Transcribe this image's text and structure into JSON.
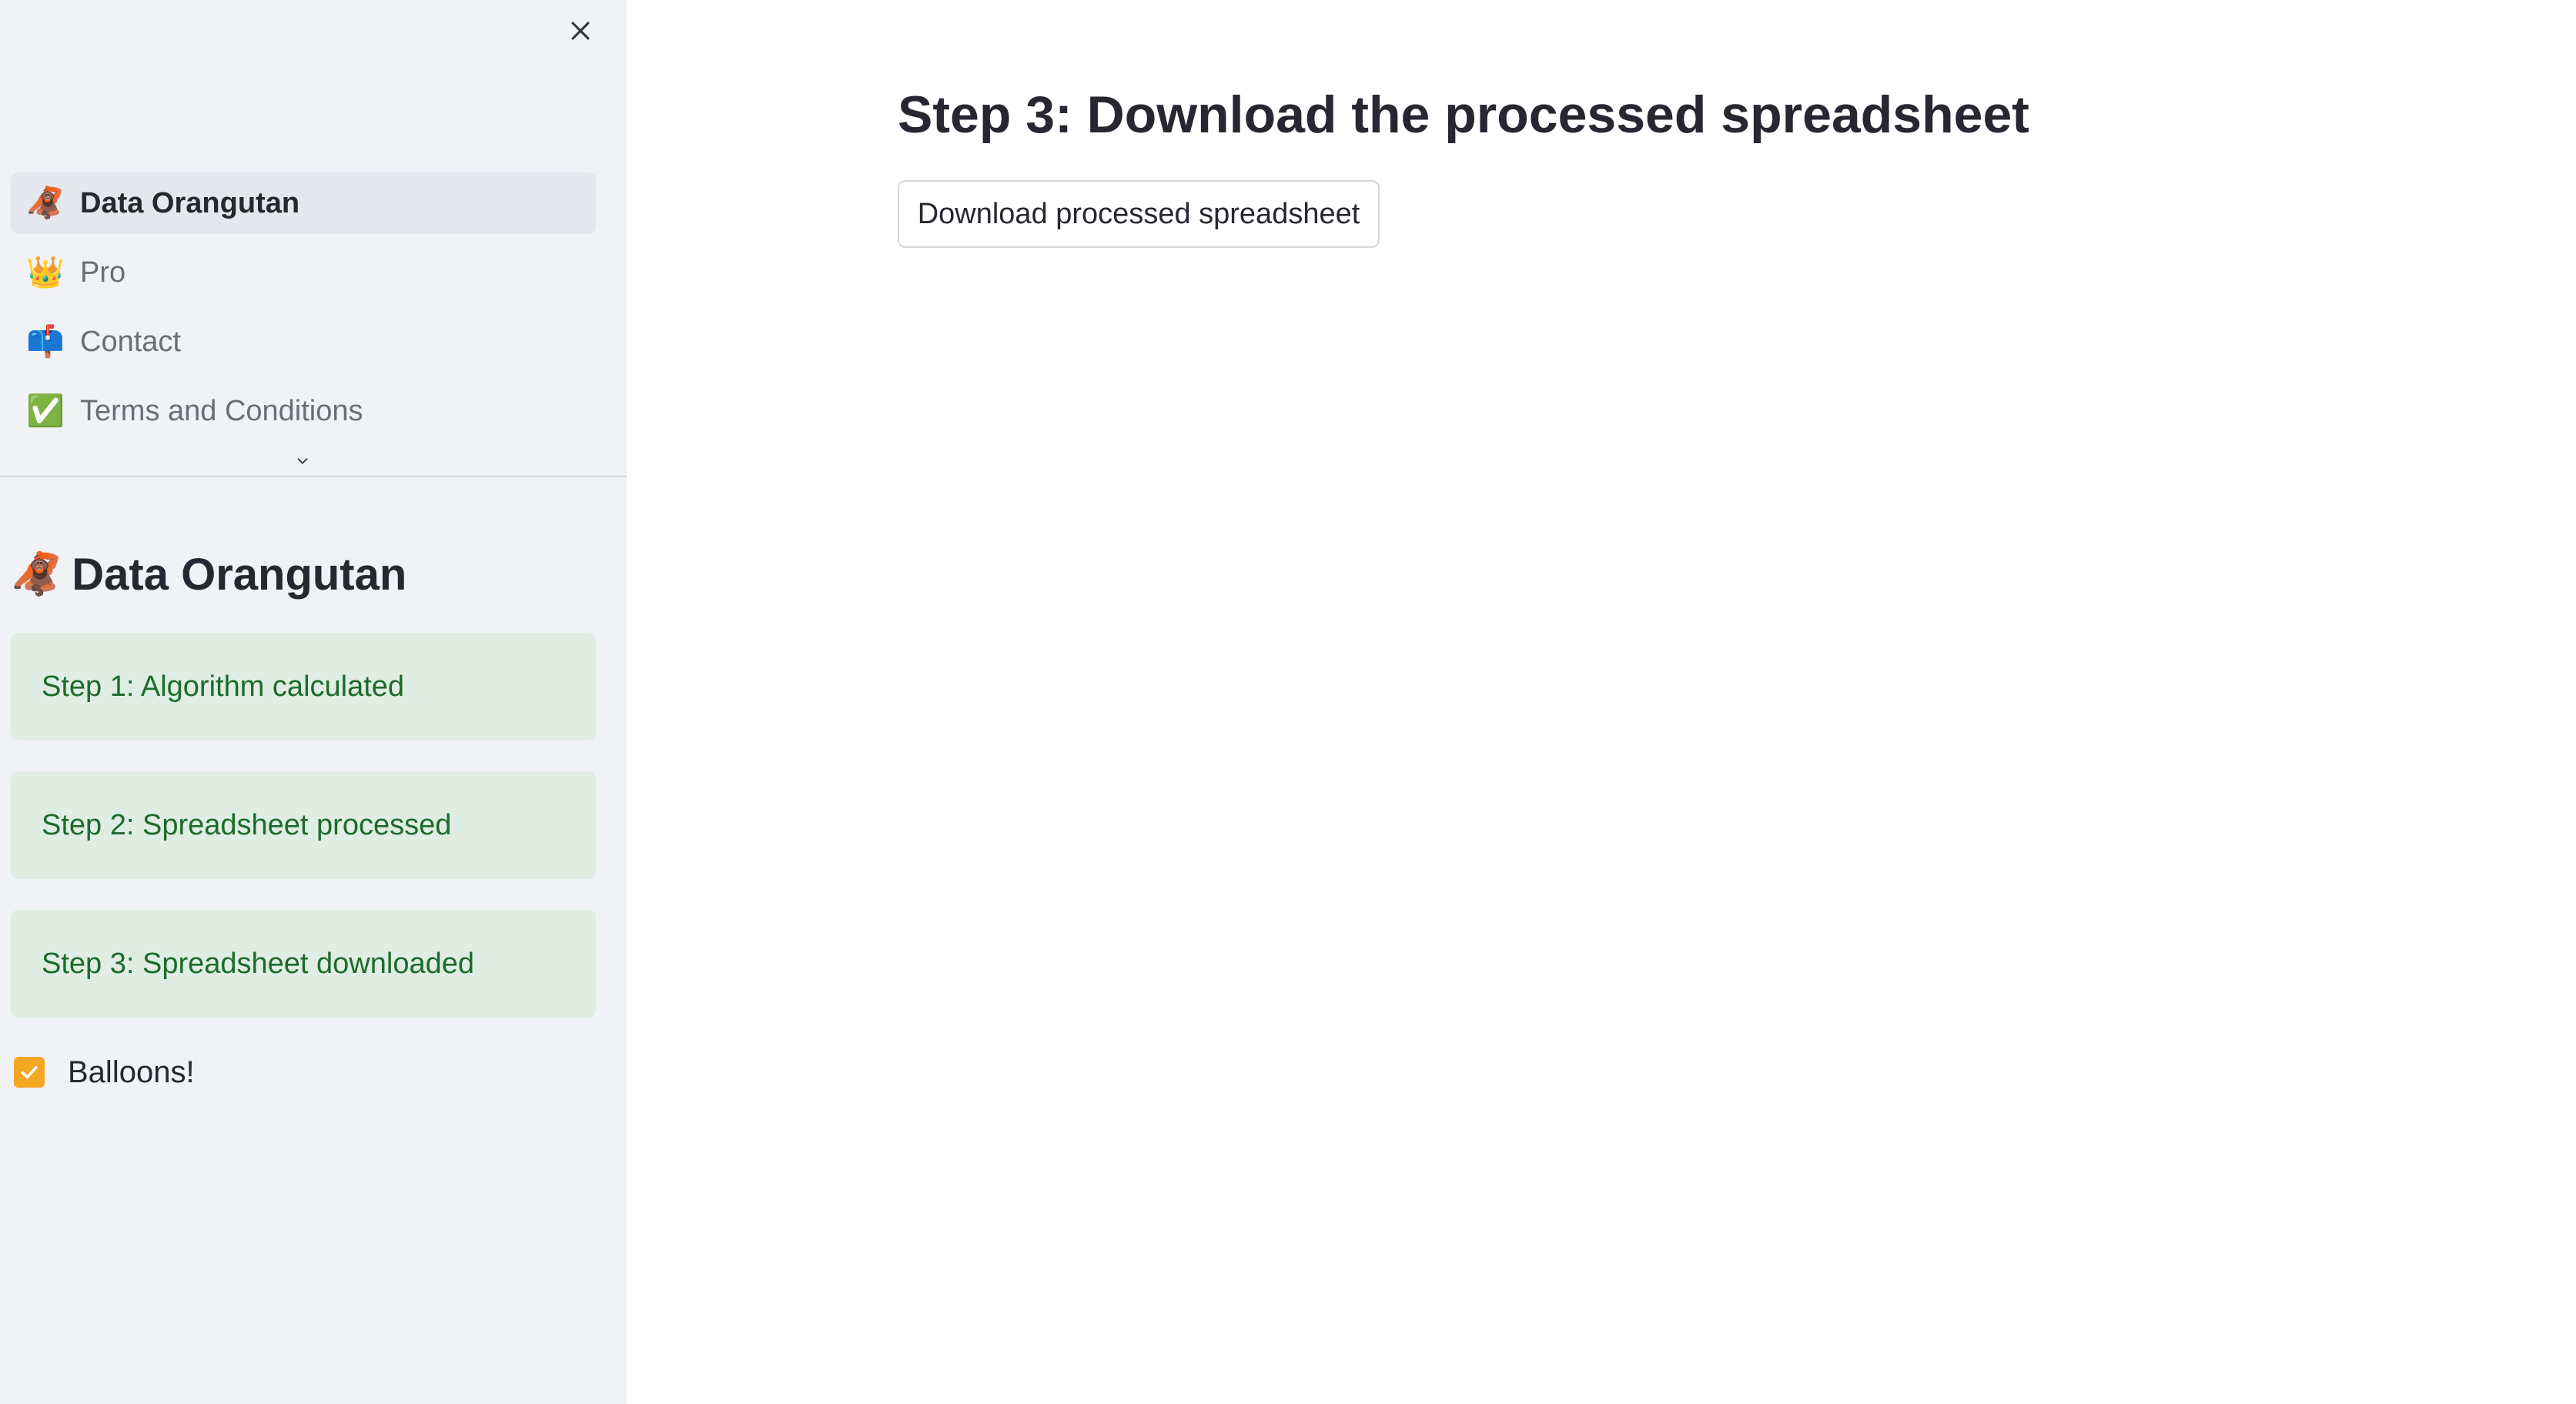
{
  "sidebar": {
    "nav": [
      {
        "icon": "orangutan-icon",
        "emoji": "🦧",
        "label": "Data Orangutan",
        "active": true
      },
      {
        "icon": "crown-icon",
        "emoji": "👑",
        "label": "Pro",
        "active": false
      },
      {
        "icon": "mailbox-icon",
        "emoji": "📫",
        "label": "Contact",
        "active": false
      },
      {
        "icon": "check-mark-button-icon",
        "emoji": "✅",
        "label": "Terms and Conditions",
        "active": false
      }
    ],
    "header": {
      "icon": "orangutan-icon",
      "emoji": "🦧",
      "title": "Data Orangutan"
    },
    "steps": [
      "Step 1: Algorithm calculated",
      "Step 2: Spreadsheet processed",
      "Step 3: Spreadsheet downloaded"
    ],
    "checkbox": {
      "label": "Balloons!",
      "checked": true
    }
  },
  "main": {
    "title": "Step 3: Download the processed spreadsheet",
    "download_button": "Download processed spreadsheet"
  },
  "colors": {
    "sidebar_bg": "#f0f2f6",
    "success_bg": "#dfede3",
    "success_text": "#1d6b2c",
    "checkbox": "#f5a623"
  }
}
